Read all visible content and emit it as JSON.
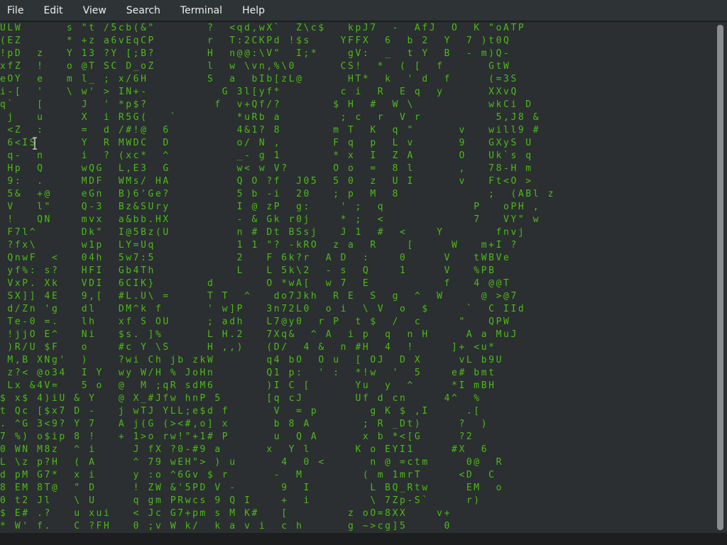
{
  "menubar": {
    "items": [
      {
        "label": "File"
      },
      {
        "label": "Edit"
      },
      {
        "label": "View"
      },
      {
        "label": "Search"
      },
      {
        "label": "Terminal"
      },
      {
        "label": "Help"
      }
    ]
  },
  "colors": {
    "menubar_bg": "#2e3436",
    "terminal_bg": "#2b2f31",
    "matrix_green": "#4cbb17",
    "highlight_white": "#ffffff"
  },
  "terminal": {
    "rows": [
      "ULW      s \"t /5cb(&\"       ?  <qd,wX`  Z\\c$   kpJ7  -  AfJ  O  K \"oATP",
      "(EZ      * +z a6vEqCP       r  T:2CKPd !$s    YFFX  6  b 2  Y  7 )t0Q",
      "!pD  z   Y 13 ?Y [;B?       H  n@@:\\V\"  I;*    gV:  _  t Y  B  - m)Q-",
      "xfZ  !   o @T SC D_oZ       l  w \\vn,%\\0      CS!  *  ( [  f      GtW",
      "eOY  e   m l_ ; x/6H        S  a  bIb[zL@      HT*  k  ' d  f     (=3S",
      "i-[  '   \\ w' > IN+-          G 3l[yf*        c i  R  E q  y      XXvQ",
      "q`   [     J  ' *p$?         f  v+Qf/?       $ H  #  W \\          wkCi D",
      " j   u     X  i R5G(   `        *uRb a        ; c  r  V r          5,J8 &",
      " <Z  :     =  d /#!@  6         4&1? 8       m T  K  q \"      v   will9 #",
      " 6<IS      Y  R MWDC  D         o/ N ,       F q  p  L v      9   GXyS U",
      " q-  n     i  ? (xc*  ^         _- g 1       * x  I  Z A      O   Uk`s q",
      " Hp  Q     wQG  L,E3  G         w< w V?      O o  =  8 l      ,   78-H m",
      " 9:  .     MDF  WMs/ HA         Q O ?f  J05  5 0  z  U I      v   Ft<O >",
      " 5&  +@    eGn  B)6'Ge?         5 b -i  20   ; p  M  8            ;  (ABl z",
      " V   l\"    Q-3  Bz&SUry         I @ zP  g:    ' ;  q            P   oPH ,",
      " !   QN    mvx  a&bb.HX         - & Gk r0j    * ;  <            7   VY\" w",
      " F7l^      Dk\"  I@5Bz(U         n # Dt BSsj   J 1  #  <    Y       fnvj",
      " ?fx\\      w1p  LY=Uq           1 1 \"? -kRO  z a  R    [     W   m+I ?",
      " QnwF  <   04h  5w7:5           2   F 6k?r  A D  :    0     V   tWBVe",
      " yf%: s?   HFI  Gb4Th           L   L 5k\\2  - s  Q    1     V   %PB",
      " VxP. Xk   VDI  6CIK}       d       O *wA[  w 7  E          f   4 @@T",
      " SX]] 4E   9,[  #L.U\\ =     T T  ^   do7Jkh  R E  S  g  ^  W     @ >@7",
      " d/Zn 'g   dl   DM^k f      ' w]P   3n72L0  o i  \\ V  o  $     `  C IId",
      " Te-0 =.   lh   xf S OU     ; adh   L7@y0  r P  t $  /  c     \"   QPW",
      " !jjO E^   Ni   $s. ]%      L H.2   7Xq&  ^ A  i p  q  n H     A a MuJ",
      " )R/U $F   o    #c Y \\S     H ,,)   (D/  4 &  n #H  4  !     ]+ <u*",
      " M,B XNg'  )    ?wi Ch jb zkW       q4 bO  O u  [ OJ  D X     vL b9U",
      " z?< @o34  I Y  wy W/H % JoHn       Q1 p:  ' :  *!w  '  5    e# bmt",
      " Lx &4V=   5 o  @  M ;qR sdM6       )I C [      Yu  y  ^     *I mBH",
      "$ x$ 4)iU & Y   @ X_#Jfw hnP 5      [q cJ       Uf d cn     4^  %",
      "t Qc [$x7 D -   j wTJ YLL;e$d f      V  = p       g K $ ,I     .[",
      ". ^G 3<9? Y 7   A j(G (><#,o] x      b 8 A       ; R _Dt)     ?  )",
      "7 %) o$ip 8 !   + 1>o rw!\"+1# P      u  Q A      x b *<[G     ?2",
      "0 WN M8z  ^ i     J fX ?0-#9 a      x  Y l      K o EYI1     #X  6",
      "L \\z p?H  ( A     ^ 79 wEH\"> ) u      4  0 <      n @ =ctm     0@  R",
      "d pM G7*  x i     y :o ^6Gv $ r      -  M        ( m 1mrT     <D  C",
      "8 EM 8T@  \" D     ! ZW &'5PD V -      9  I        L BQ_Rtw     EM  o",
      "0 t2 Jl   \\ U     q gm PRwcs 9 Q I    +  i        \\ 7Zp-S`     r)",
      "$ E# .?   u xui   < Jc G7+pm s M K#   [        z oO=8XX    v+",
      "* W' f.   C ?FH   0 ;v W k/  k a v i  c h      g ~>cg]5     0"
    ]
  }
}
